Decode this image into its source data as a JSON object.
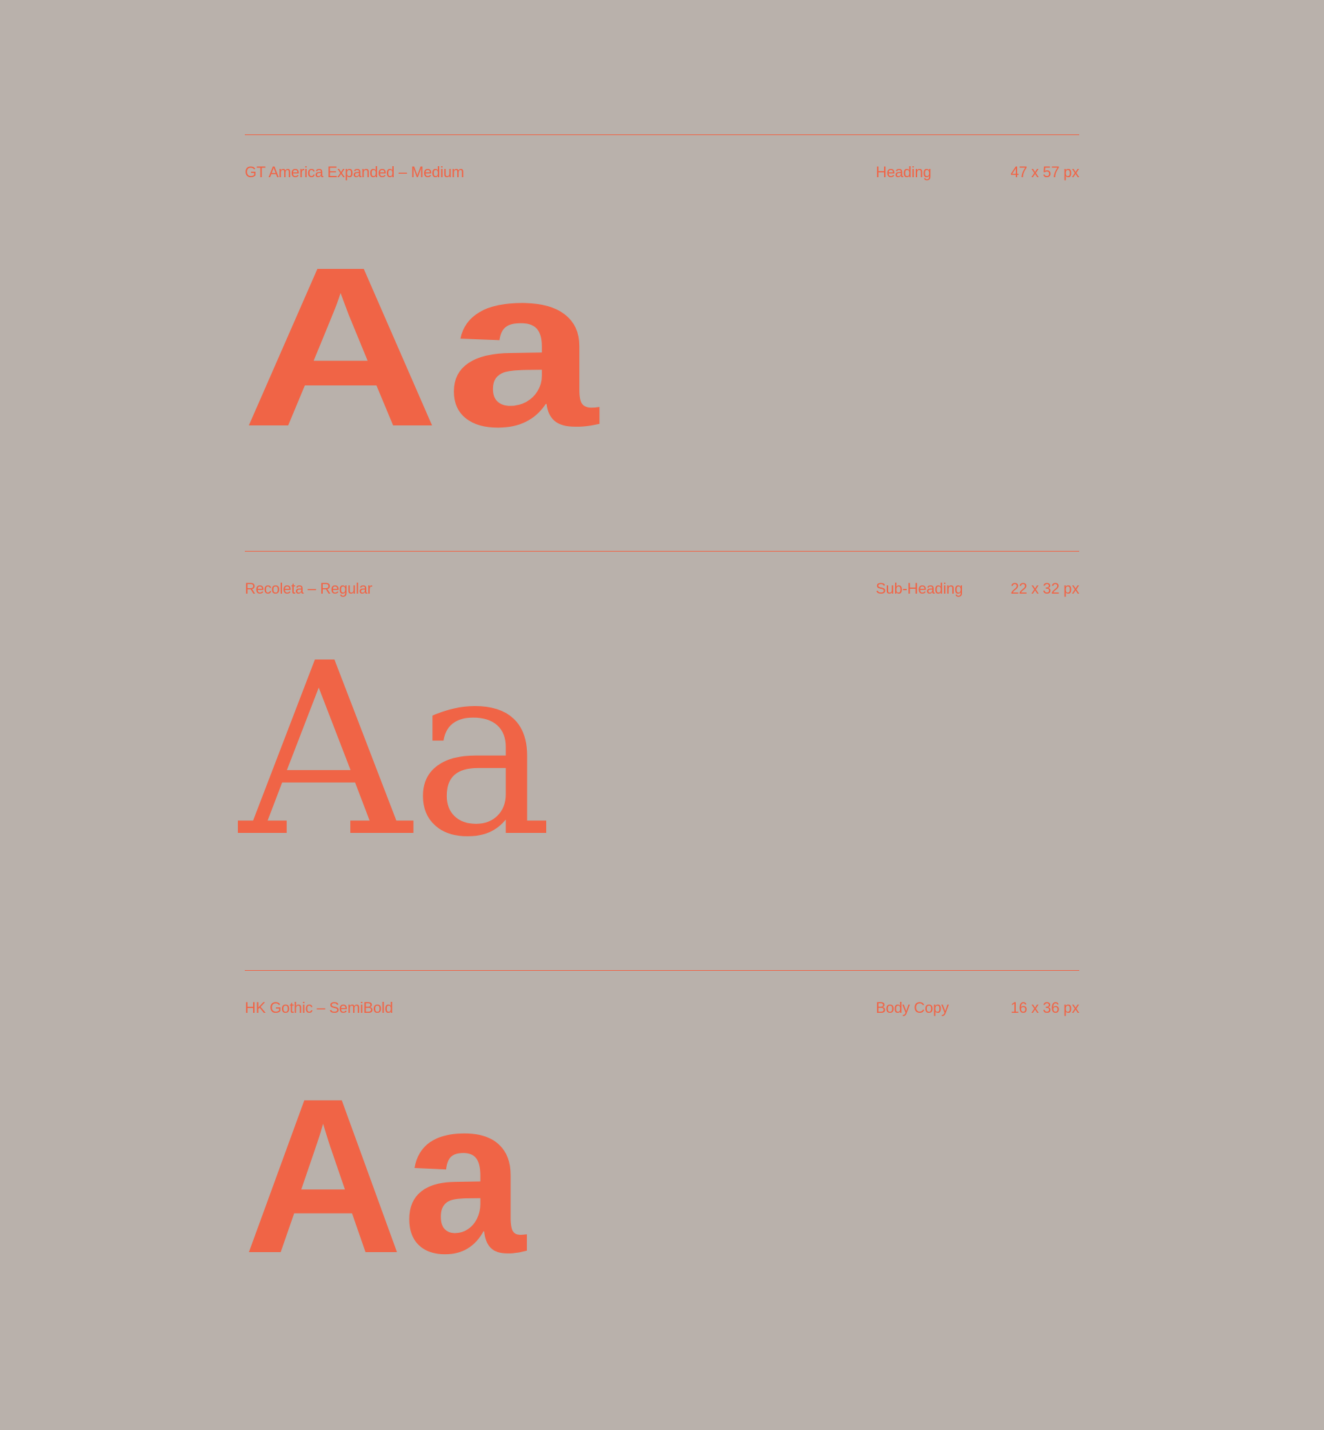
{
  "colors": {
    "background": "#b9b1ab",
    "accent": "#f06446"
  },
  "specimens": [
    {
      "font_name": "GT America Expanded  – Medium",
      "role": "Heading",
      "size": "47 x 57 px",
      "sample_upper": "A",
      "sample_lower": "a"
    },
    {
      "font_name": "Recoleta – Regular",
      "role": "Sub-Heading",
      "size": "22 x 32 px",
      "sample_upper": "A",
      "sample_lower": "a"
    },
    {
      "font_name": "HK Gothic – SemiBold",
      "role": "Body Copy",
      "size": "16 x 36 px",
      "sample_upper": "A",
      "sample_lower": "a"
    }
  ]
}
